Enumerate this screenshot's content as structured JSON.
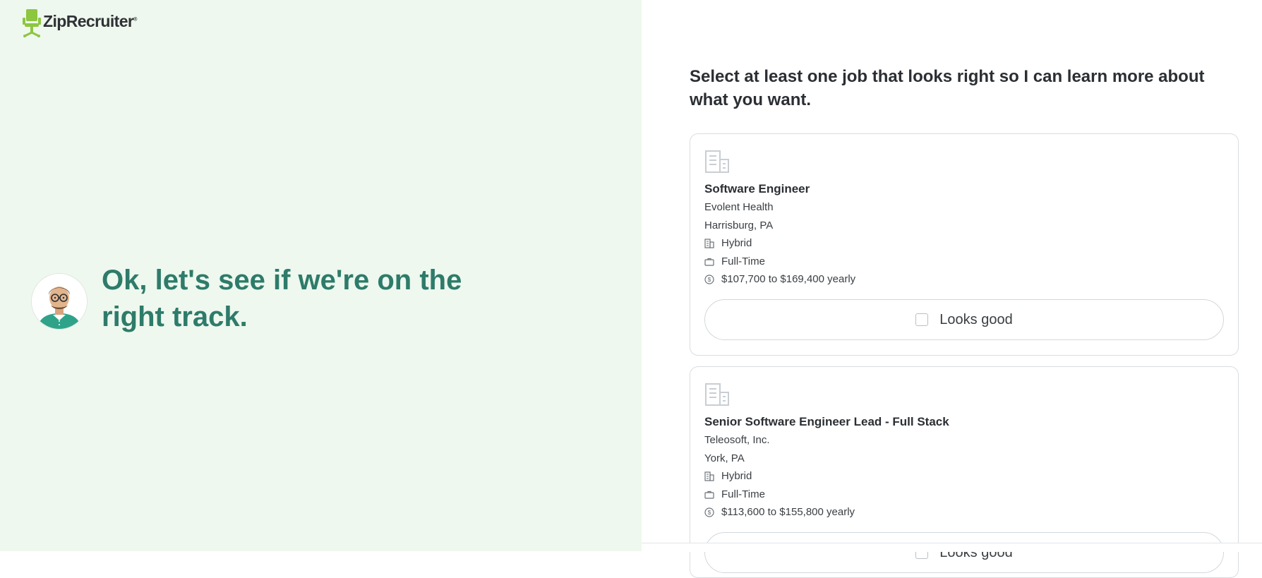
{
  "brand": {
    "name": "ZipRecruiter",
    "registered_mark": "®",
    "accent_color": "#8dc63f"
  },
  "left": {
    "headline": "Ok, let's see if we're on the right track.",
    "headline_color": "#2e7b6a",
    "avatar": "assistant-avatar"
  },
  "right": {
    "prompt": "Select at least one job that looks right so I can learn more about what you want.",
    "jobs": [
      {
        "title": "Software Engineer",
        "company": "Evolent Health",
        "location": "Harrisburg, PA",
        "work_model": "Hybrid",
        "employment_type": "Full-Time",
        "salary": "$107,700 to $169,400 yearly",
        "action_label": "Looks good",
        "checked": false
      },
      {
        "title": "Senior Software Engineer Lead - Full Stack",
        "company": "Teleosoft, Inc.",
        "location": "York, PA",
        "work_model": "Hybrid",
        "employment_type": "Full-Time",
        "salary": "$113,600 to $155,800 yearly",
        "action_label": "Looks good",
        "checked": false
      }
    ]
  },
  "icons": {
    "company": "building-icon",
    "work_model": "building-small-icon",
    "employment_type": "briefcase-icon",
    "salary": "dollar-circle-icon"
  }
}
